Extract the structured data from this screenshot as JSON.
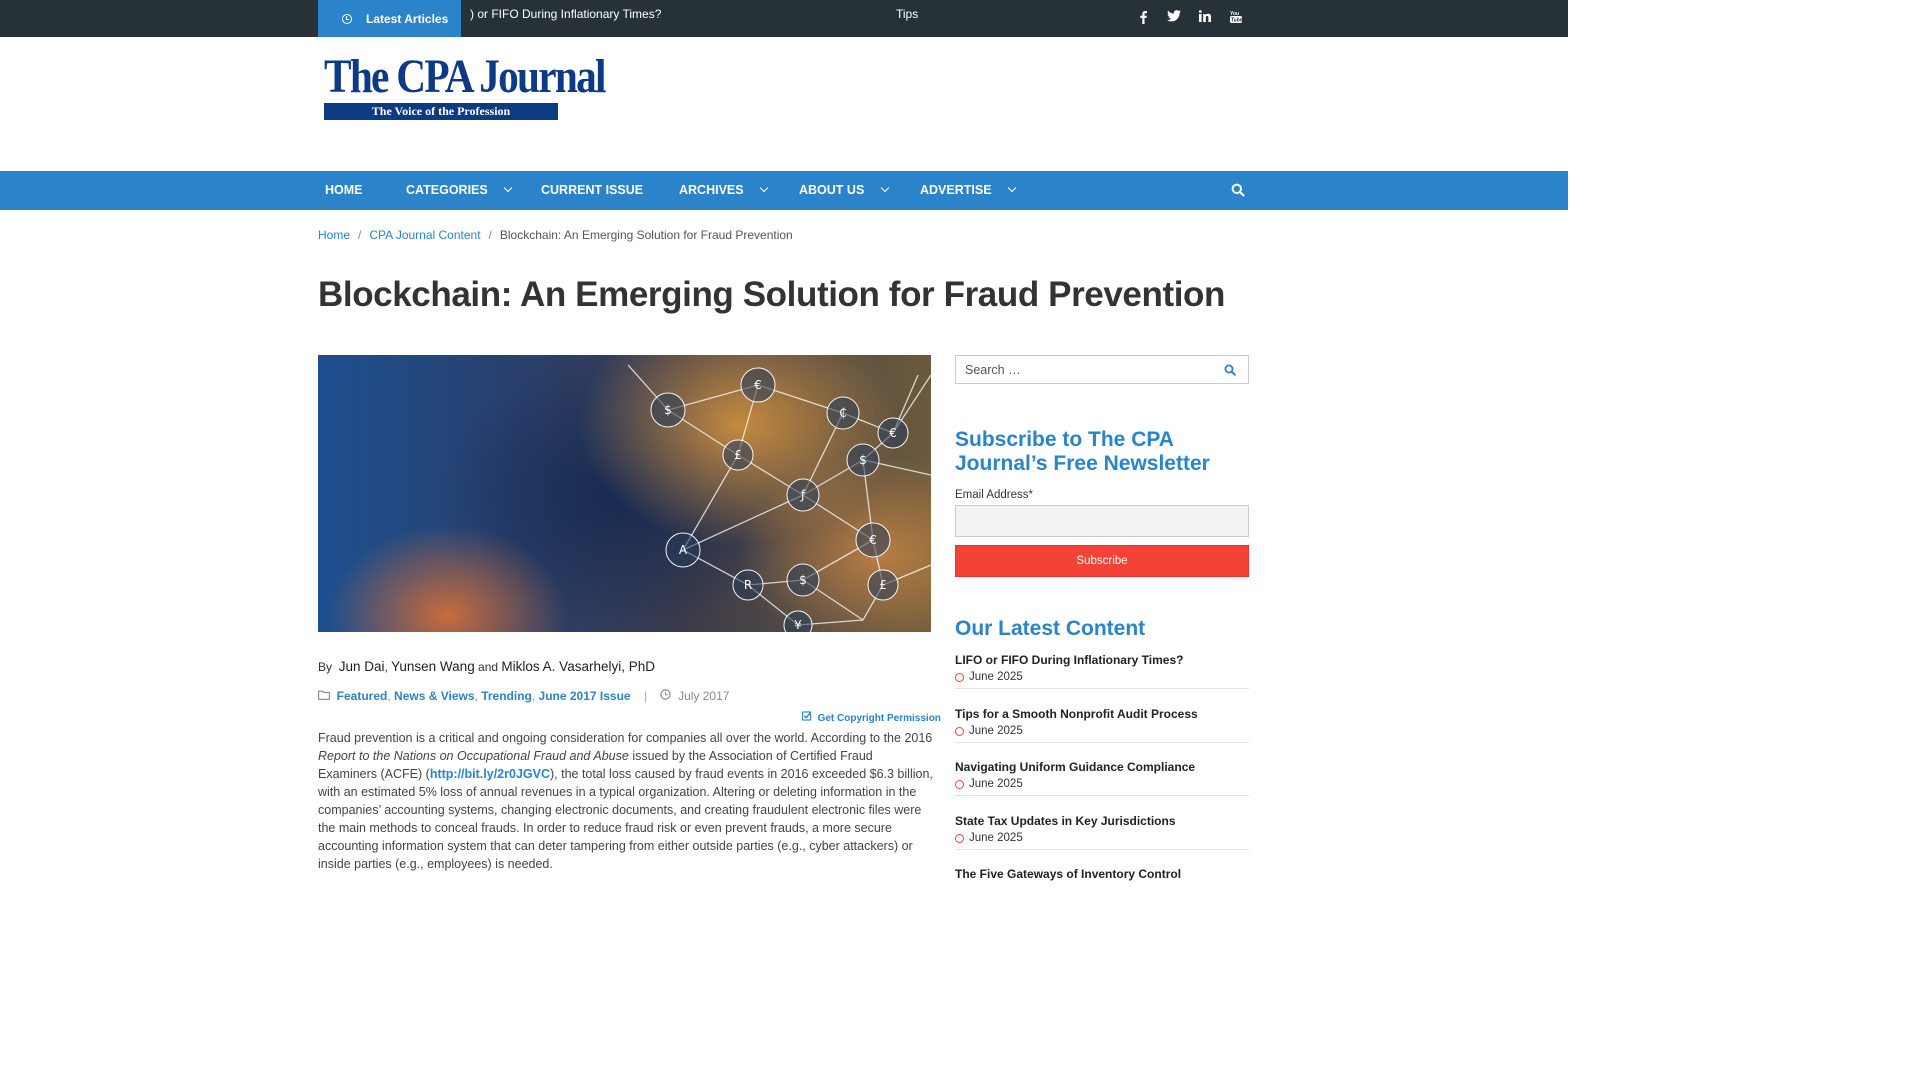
{
  "topbar": {
    "latest_label": "Latest Articles",
    "ticker_1": ") or FIFO During Inflationary Times?",
    "ticker_2": "Tips",
    "social": [
      "f",
      "twitter",
      "in",
      "youtube"
    ]
  },
  "logo": {
    "name": "The CPA Journal",
    "tagline": "The Voice of the Profession"
  },
  "nav": {
    "items": [
      "HOME",
      "CATEGORIES",
      "CURRENT ISSUE",
      "ARCHIVES",
      "ABOUT US",
      "ADVERTISE"
    ]
  },
  "breadcrumb": {
    "home": "Home",
    "section": "CPA Journal Content",
    "current": "Blockchain: An Emerging Solution for Fraud Prevention"
  },
  "article": {
    "title": "Blockchain: An Emerging Solution for Fraud Prevention",
    "by": "By",
    "author_1": "Jun Dai",
    "author_2": "Yunsen Wang",
    "and": "and",
    "author_3": "Miklos A. Vasarhelyi, PhD",
    "cat_1": "Featured",
    "cat_2": "News & Views",
    "cat_3": "Trending",
    "cat_4": "June 2017 Issue",
    "date": "July 2017",
    "permission": "Get Copyright Permission",
    "p1_a": "Fraud prevention is a critical and ongoing consideration for companies all over the world. According to the 2016 ",
    "p1_em": "Report to the Nations on Occupational Fraud and Abuse",
    "p1_b": " issued by the Association of Certified Fraud Examiners (ACFE) (",
    "p1_link": "http://bit.ly/2r0JGVC",
    "p1_c": "), the total loss caused by fraud events in 2016 exceeded $6.3 billion, with an estimated 5% loss of annual revenues in a typical organization. Altering or deleting information in the companies’ accounting systems, changing electronic documents, and creating fraudulent electronic files were the main methods to conceal frauds. In order to reduce fraud risk or even prevent frauds, a more secure accounting information system that can deter tampering from either outside parties (e.g., cyber attackers) or inside parties (e.g., employees) is needed."
  },
  "sidebar": {
    "search_placeholder": "Search …",
    "subscribe_title": "Subscribe to The CPA Journal’s Free Newsletter",
    "email_label": "Email Address*",
    "subscribe_button": "Subscribe",
    "latest_title": "Our Latest Content",
    "latest": [
      {
        "title": "LIFO or FIFO During Inflationary Times?",
        "date": "June 2025"
      },
      {
        "title": "Tips for a Smooth Nonprofit Audit Process",
        "date": "June 2025"
      },
      {
        "title": "Navigating Uniform Guidance Compliance",
        "date": "June 2025"
      },
      {
        "title": "State Tax Updates in Key Jurisdictions",
        "date": "June 2025"
      },
      {
        "title": "The Five Gateways of Inventory Control",
        "date": ""
      }
    ]
  },
  "colors": {
    "accent": "#2b83c9",
    "topbar": "#263238",
    "subscribe": "#f44336",
    "brand": "#0d3a84"
  }
}
